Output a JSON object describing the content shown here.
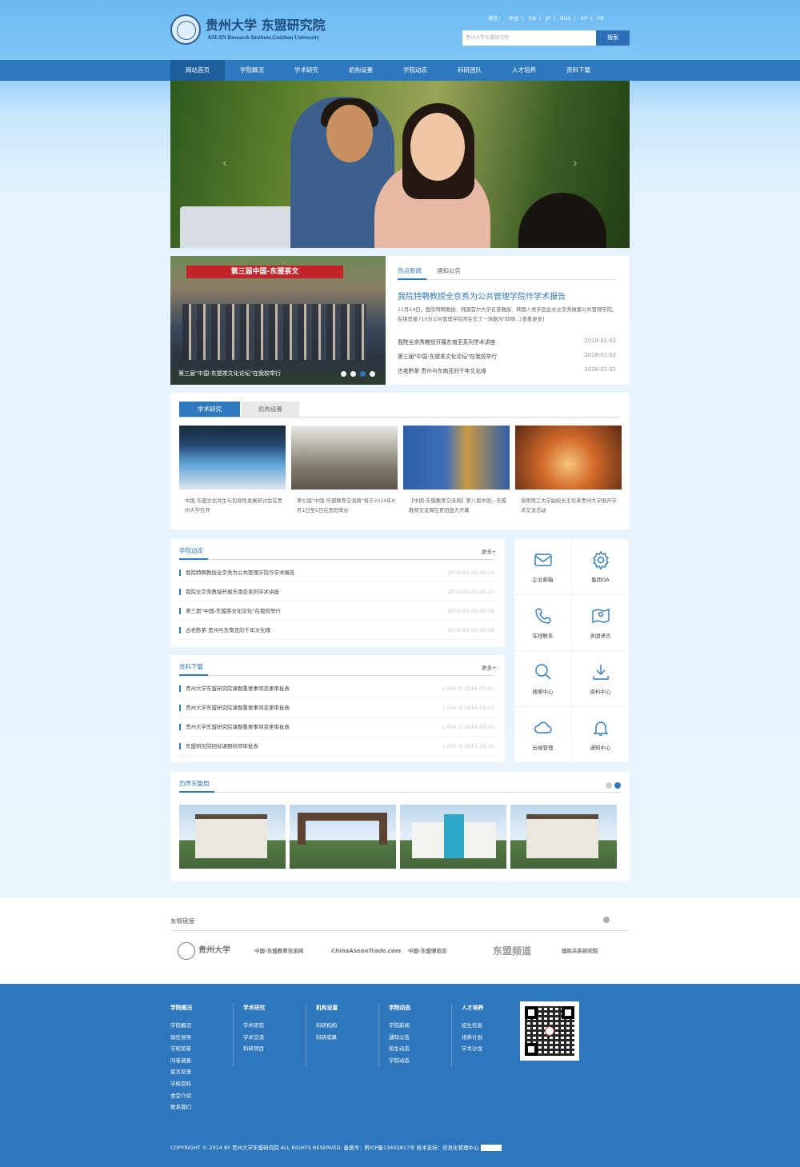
{
  "header": {
    "logo_cn": "贵州大学 东盟研究院",
    "logo_en": "ASEAN Research Institute,Guizhou University",
    "lang_label": "语言：",
    "languages": [
      "中文",
      "EN",
      "JP",
      "RUS",
      "KP",
      "FR"
    ],
    "search_placeholder": "贵州大学东盟研究院",
    "search_button": "搜索"
  },
  "nav": [
    "网站首页",
    "学院概况",
    "学术研究",
    "机构设置",
    "学院动态",
    "科研团队",
    "人才培养",
    "资料下载"
  ],
  "news": {
    "image_caption": "第三届\"中国-东盟茶文化论坛\"在我校举行",
    "banner_text": "第三届中国-东盟茶文",
    "tabs": [
      "热点新闻",
      "通知公告"
    ],
    "headline": "我院特聘教授全京秀为公共管理学院作学术报告",
    "summary": "11月14日，我院特聘教授、韩国首尔大学名誉教授、韩国人类学会会长全京秀做客公共管理学院，在锦思楼710为公共管理学院师生作了一场题为\"四律...[查看更多]",
    "items": [
      {
        "title": "我院全京秀教授开展东南亚系列学术讲座",
        "date": "2018-01-02"
      },
      {
        "title": "第三届\"中国-东盟茶文化论坛\"在我校举行",
        "date": "2018-01-02"
      },
      {
        "title": "古老黔茶 贵州与东南亚的千年文化缘",
        "date": "2018-01-02"
      }
    ]
  },
  "research": {
    "tabs": [
      "学术研究",
      "机构设置"
    ],
    "items": [
      "中国-东盟文化共生与包容性发展研讨会在贵州大学召开",
      "第七届\"中国-东盟教育交流周\"将于2014年9月1日至5日在贵阳举办",
      "【中国-东盟教育交流周】第八届中国—东盟教育交流周在贵阳盛大开幕",
      "昆明理工大学副校长王华来贵州大学展开学术交流活动"
    ]
  },
  "dynamics": {
    "title": "学院动态",
    "more": "更多+",
    "items": [
      {
        "title": "我院特聘教授全京秀为公共管理学院作学术报告",
        "date": "2018-01-02 00:11"
      },
      {
        "title": "我院全京秀教授开展东南亚系列学术讲座",
        "date": "2018-01-02 00:11"
      },
      {
        "title": "第三届\"中国-东盟茶文化论坛\"在我校举行",
        "date": "2018-01-02 00:08"
      },
      {
        "title": "古老黔茶 贵州与东南亚的千年文化缘",
        "date": "2018-01-02 00:08"
      }
    ]
  },
  "downloads": {
    "title": "资料下载",
    "more": "更多+",
    "items": [
      {
        "title": "贵州大学东盟研究院课题重要事项变更审批表",
        "count": "554",
        "date": "2018-01-01"
      },
      {
        "title": "贵州大学东盟研究院课题重要事项变更审批表",
        "count": "554",
        "date": "2018-01-01"
      },
      {
        "title": "贵州大学东盟研究院课题重要事项变更审批表",
        "count": "554",
        "date": "2018-01-01"
      },
      {
        "title": "东盟研究院招标课题结项审批表",
        "count": "205",
        "date": "2015-12-31"
      }
    ]
  },
  "tiles": [
    {
      "label": "企业邮箱",
      "icon": "mail-icon"
    },
    {
      "label": "集团OA",
      "icon": "gear-icon"
    },
    {
      "label": "在线联系",
      "icon": "phone-icon"
    },
    {
      "label": "多国语言",
      "icon": "map-icon"
    },
    {
      "label": "搜索中心",
      "icon": "search-icon"
    },
    {
      "label": "资料中心",
      "icon": "download-icon"
    },
    {
      "label": "云端管理",
      "icon": "cloud-icon"
    },
    {
      "label": "通知中心",
      "icon": "bell-icon"
    }
  ],
  "campus": {
    "title": "历界东盟周"
  },
  "links": {
    "title": "友情链接",
    "logos": [
      "贵州大学",
      "中国-东盟教育信息网",
      "ChinaAseanTrade.com",
      "中国-东盟博览会",
      "东盟频道",
      "国际关系研究院"
    ]
  },
  "footer": {
    "columns": [
      {
        "head": "学院概况",
        "items": [
          "学院概况",
          "现任领导",
          "学校荣誉",
          "问卷调查",
          "留言反馈",
          "学校百科",
          "食堂介绍",
          "联系我们"
        ]
      },
      {
        "head": "学术研究",
        "items": [
          "学术研究",
          "学术交流",
          "科研项目"
        ]
      },
      {
        "head": "机构设置",
        "items": [
          "科研机构",
          "科研成果"
        ]
      },
      {
        "head": "学院动态",
        "items": [
          "学院新闻",
          "通知公告",
          "招生动态",
          "学院动态"
        ]
      },
      {
        "head": "人才培养",
        "items": [
          "招生信息",
          "培养计划",
          "学术沙龙"
        ]
      }
    ],
    "copyright": "COPYRIGHT © 2014 BY 贵州大学东盟研究院 ALL RIGHTS RESERVED. 备案号：黔ICP备13402817号   技术支持：信息化管理中心"
  },
  "colors": {
    "primary": "#2e79bd",
    "nav": "#2e79bd",
    "nav_active": "#1e5f9b",
    "footer": "#2e77bd",
    "header_bg": "#6cbaf3"
  }
}
